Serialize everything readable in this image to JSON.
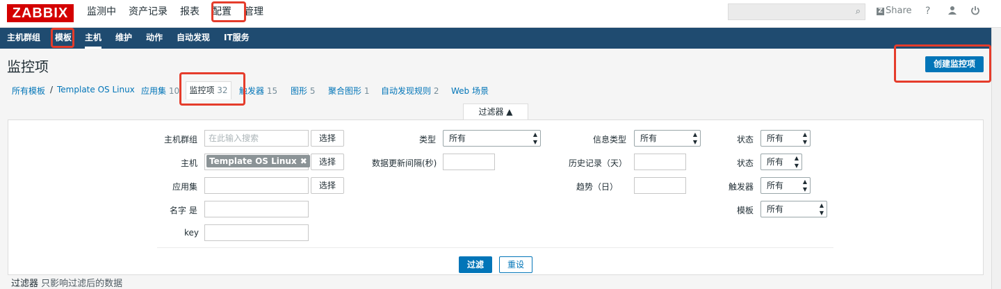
{
  "logo": "ZABBIX",
  "main_nav": [
    "监测中",
    "资产记录",
    "报表",
    "配置",
    "管理"
  ],
  "search": {
    "placeholder": "",
    "icon": "search-icon"
  },
  "top_right": {
    "share": "Share",
    "help": "?",
    "user_icon": "user-icon",
    "power_icon": "power-icon"
  },
  "sub_nav": [
    "主机群组",
    "模板",
    "主机",
    "维护",
    "动作",
    "自动发现",
    "IT服务"
  ],
  "page_title": "监控项",
  "create_button": "创建监控项",
  "breadcrumb": {
    "all_templates": "所有模板",
    "separator": "/",
    "template": "Template OS Linux",
    "tabs": [
      {
        "label": "应用集",
        "count": "10"
      },
      {
        "label": "监控项",
        "count": "32"
      },
      {
        "label": "触发器",
        "count": "15"
      },
      {
        "label": "图形",
        "count": "5"
      },
      {
        "label": "聚合图形",
        "count": "1"
      },
      {
        "label": "自动发现规则",
        "count": "2"
      },
      {
        "label": "Web 场景",
        "count": ""
      }
    ]
  },
  "filter": {
    "tab_label": "过滤器 ▲",
    "host_group_label": "主机群组",
    "host_group_placeholder": "在此输入搜索",
    "select_label": "选择",
    "host_label": "主机",
    "host_tag": "Template OS Linux",
    "app_label": "应用集",
    "name_label": "名字 是",
    "key_label": "key",
    "type_label": "类型",
    "type_value": "所有",
    "interval_label": "数据更新间隔(秒)",
    "info_type_label": "信息类型",
    "info_type_value": "所有",
    "history_label": "历史记录（天）",
    "trends_label": "趋势（日）",
    "status1_label": "状态",
    "status1_value": "所有",
    "status2_label": "状态",
    "status2_value": "所有",
    "triggers_label": "触发器",
    "triggers_value": "所有",
    "template_label": "模板",
    "template_value": "所有",
    "apply_button": "过滤",
    "reset_button": "重设"
  },
  "footer_note": {
    "label": "过滤器",
    "text": "只影响过滤后的数据"
  },
  "highlight_color": "#e53c2b"
}
